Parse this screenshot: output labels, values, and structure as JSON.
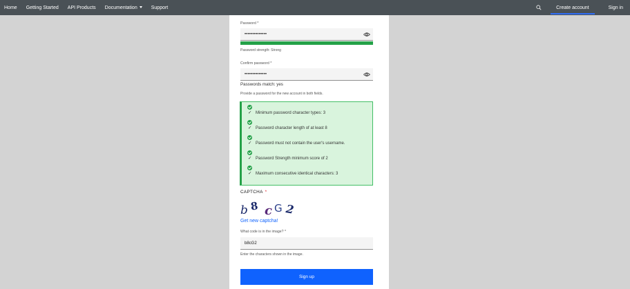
{
  "nav": {
    "items": [
      "Home",
      "Getting Started",
      "API Products",
      "Documentation",
      "Support"
    ],
    "create_account": "Create account",
    "sign_in": "Sign in"
  },
  "form": {
    "password_label": "Password",
    "password_value": "••••••••••••••",
    "strength_fill": 1.0,
    "strength_text": "Password strength: Strong",
    "confirm_label": "Confirm password",
    "confirm_value": "••••••••••••••",
    "match_text": "Passwords match: yes",
    "help_text": "Provide a password for the new account in both fields.",
    "required_marker": "*",
    "requirements": [
      "Minimum password character types: 3",
      "Password character length of at least 8",
      "Password must not contain the user's username.",
      "Password Strength minimum score of 2",
      "Maximum consecutive identical characters: 3"
    ],
    "check_glyph": "✓",
    "captcha_title": "CAPTCHA",
    "new_captcha": "Get new captcha!",
    "code_label": "What code is in the image?",
    "code_value": "b8cG2",
    "code_help": "Enter the characters shown in the image.",
    "submit": "Sign up"
  },
  "colors": {
    "nav_bg": "#4a5156",
    "page_bg": "#d3d3d3",
    "success": "#24a148",
    "primary": "#0f62fe"
  }
}
